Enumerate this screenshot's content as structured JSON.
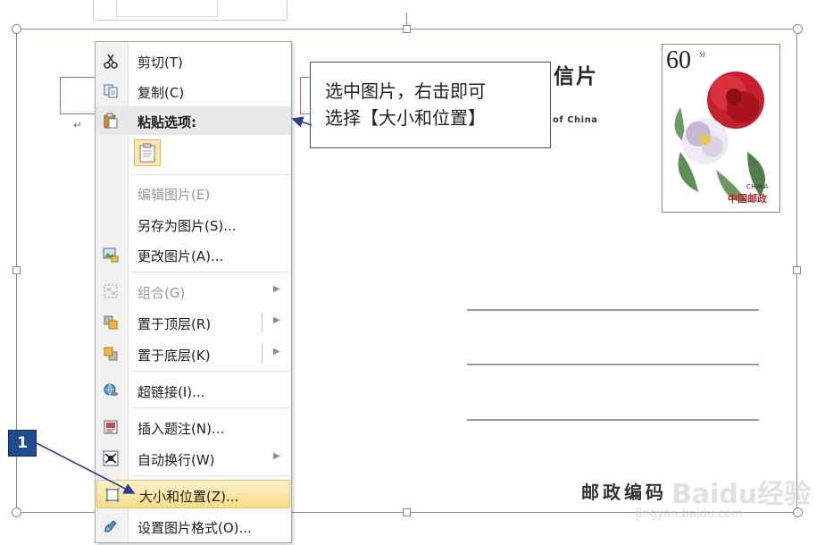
{
  "context_menu": {
    "items": [
      {
        "label": "剪切(T)",
        "icon": "scissors-icon",
        "enabled": true
      },
      {
        "label": "复制(C)",
        "icon": "copy-icon",
        "enabled": true
      },
      {
        "label": "粘贴选项:",
        "icon": "paste-icon",
        "enabled": true,
        "header": true
      },
      {
        "label": "编辑图片(E)",
        "enabled": false
      },
      {
        "label": "另存为图片(S)...",
        "enabled": true
      },
      {
        "label": "更改图片(A)...",
        "icon": "change-picture-icon",
        "enabled": true
      },
      {
        "label": "组合(G)",
        "icon": "group-icon",
        "enabled": false,
        "submenu": true
      },
      {
        "label": "置于顶层(R)",
        "icon": "bring-to-front-icon",
        "enabled": true,
        "submenu": true
      },
      {
        "label": "置于底层(K)",
        "icon": "send-to-back-icon",
        "enabled": true,
        "submenu": true
      },
      {
        "label": "超链接(I)...",
        "icon": "hyperlink-icon",
        "enabled": true
      },
      {
        "label": "插入题注(N)...",
        "icon": "insert-caption-icon",
        "enabled": true
      },
      {
        "label": "自动换行(W)",
        "icon": "text-wrap-icon",
        "enabled": true,
        "submenu": true
      },
      {
        "label": "大小和位置(Z)...",
        "icon": "size-position-icon",
        "enabled": true,
        "highlighted": true
      },
      {
        "label": "设置图片格式(O)...",
        "icon": "format-picture-icon",
        "enabled": true
      }
    ]
  },
  "callout": {
    "line1": "选中图片，右击即可",
    "line2": "选择【大小和位置】"
  },
  "step_badge": "1",
  "postcard": {
    "title": "信片",
    "subtitle": "of China",
    "stamp_value": "60",
    "stamp_unit": "分",
    "stamp_country": "CHINA",
    "stamp_post": "中国邮政",
    "postcode_label": "邮政编码",
    "paragraph_mark": "↵"
  },
  "watermark": {
    "text": "Baidu经验",
    "url": "jingyan.baidu.com"
  },
  "colors": {
    "highlight": "#f8dd86",
    "badge": "#1f4b8f",
    "frame": "#7f8fa8",
    "callout_border": "#3f4f7a",
    "postcard_box": "#b9656a"
  }
}
